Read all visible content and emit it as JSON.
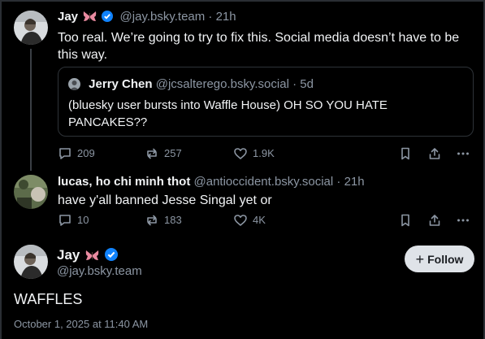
{
  "post1": {
    "author_name": "Jay",
    "author_handle": "@jay.bsky.team",
    "separator": "·",
    "time": "21h",
    "text_line1": "Too real. We’re going to try to fix this. Social media doesn’t have to be",
    "text_line2": "this way.",
    "quote": {
      "author_name": "Jerry Chen",
      "author_handle": "@jcsalterego.bsky.social",
      "separator": "·",
      "time": "5d",
      "text_line1": "(bluesky user bursts into Waffle House) OH SO YOU HATE",
      "text_line2": "PANCAKES??"
    },
    "replies": "209",
    "reposts": "257",
    "likes": "1.9K"
  },
  "post2": {
    "author_name": "lucas, ho chi minh thot",
    "author_handle": "@antioccident.bsky.social",
    "separator": "·",
    "time": "21h",
    "text": "have y'all banned Jesse Singal yet or",
    "replies": "10",
    "reposts": "183",
    "likes": "4K"
  },
  "main_post": {
    "author_name": "Jay",
    "author_handle": "@jay.bsky.team",
    "follow_label": "Follow",
    "text": "WAFFLES",
    "date": "October 1, 2025 at 11:40 AM"
  },
  "colors": {
    "background": "#000000",
    "text": "#f1f3f5",
    "muted": "#8c96a3",
    "verified": "#1083fe",
    "follow_bg": "#dfe3e8"
  },
  "icons": [
    "butterfly-emoji-icon",
    "verified-icon",
    "reply-icon",
    "repost-icon",
    "like-icon",
    "bookmark-icon",
    "share-icon",
    "more-icon"
  ]
}
